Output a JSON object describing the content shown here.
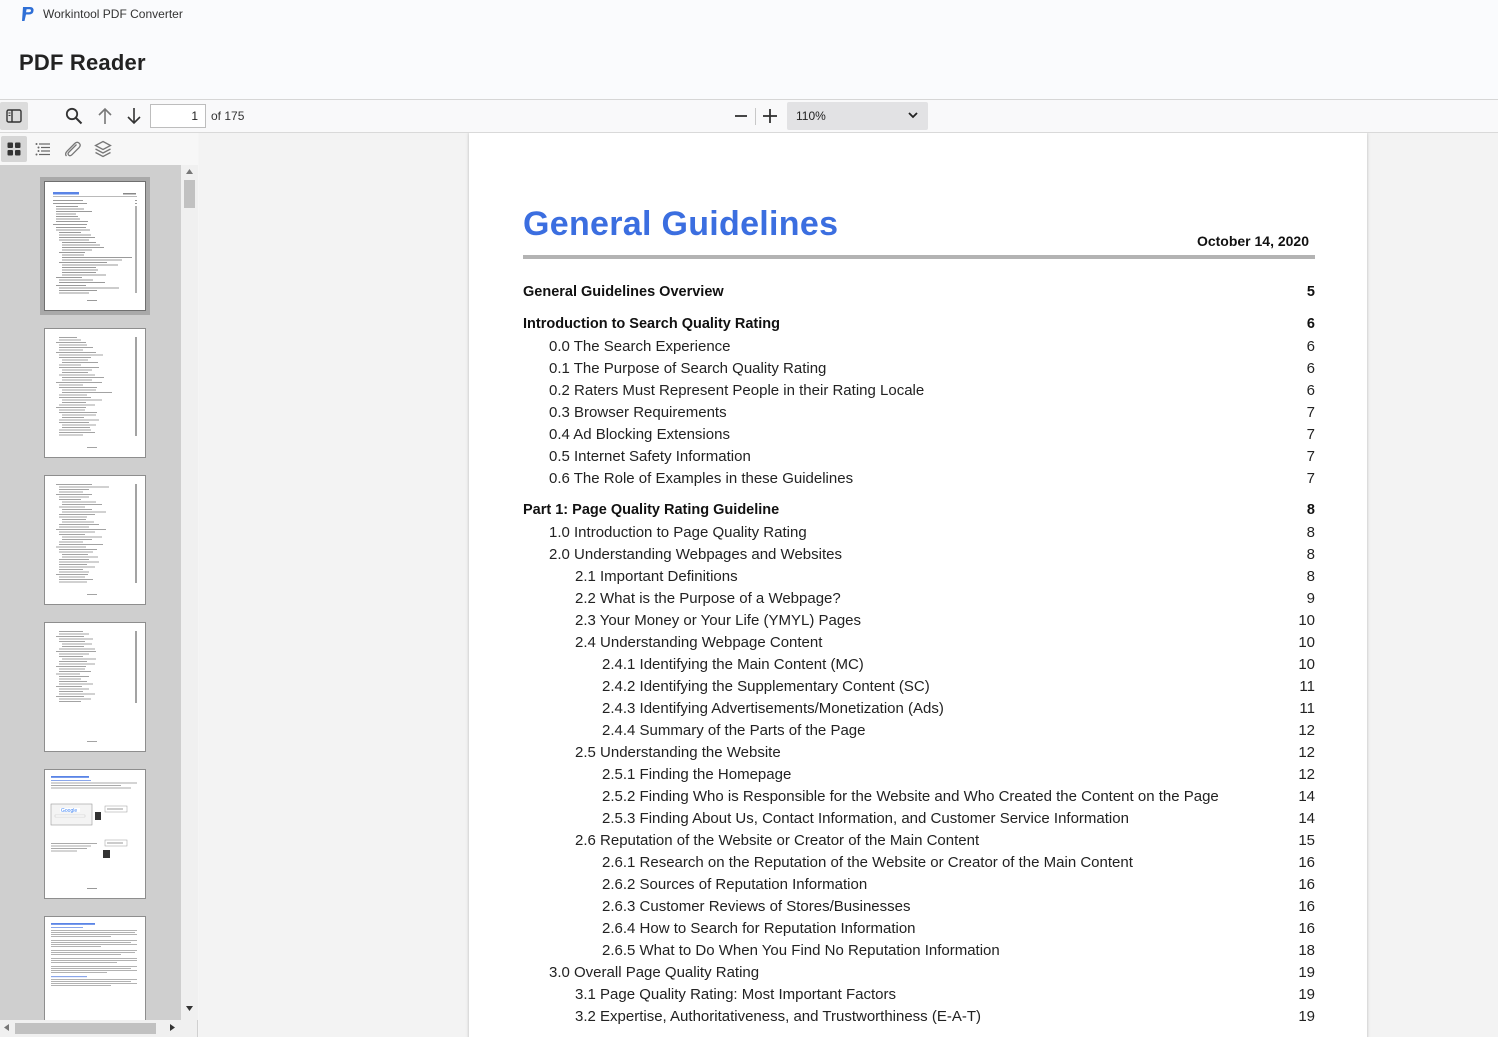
{
  "app": {
    "window_title": "Workintool PDF Converter",
    "heading": "PDF Reader"
  },
  "toolbar": {
    "page_input_value": "1",
    "page_count": "of 175",
    "zoom_value": "110%"
  },
  "icons": {
    "sidebar_toggle": "sidebar-toggle-icon",
    "search": "search-icon",
    "prev": "arrow-up-icon",
    "next": "arrow-down-icon",
    "zoom_out": "minus-icon",
    "zoom_in": "plus-icon",
    "thumbnails": "grid-icon",
    "outline": "list-icon",
    "attachments": "paperclip-icon",
    "layers": "layers-icon"
  },
  "colors": {
    "title_blue": "#3b6ee0",
    "logo_blue": "#2f6fd6"
  },
  "document": {
    "title": "General Guidelines",
    "date": "October 14, 2020",
    "toc": [
      {
        "label": "General Guidelines Overview",
        "page": "5",
        "level": 0
      },
      {
        "label": "Introduction to Search Quality Rating",
        "page": "6",
        "level": 0
      },
      {
        "label": "0.0 The Search Experience",
        "page": "6",
        "level": 1
      },
      {
        "label": "0.1 The Purpose of Search Quality Rating",
        "page": "6",
        "level": 1
      },
      {
        "label": "0.2 Raters Must Represent People in their Rating Locale",
        "page": "6",
        "level": 1
      },
      {
        "label": "0.3 Browser Requirements",
        "page": "7",
        "level": 1
      },
      {
        "label": "0.4 Ad Blocking Extensions",
        "page": "7",
        "level": 1
      },
      {
        "label": "0.5 Internet Safety Information",
        "page": "7",
        "level": 1
      },
      {
        "label": "0.6 The Role of Examples in these Guidelines",
        "page": "7",
        "level": 1
      },
      {
        "label": "Part 1: Page Quality Rating Guideline",
        "page": "8",
        "level": 0
      },
      {
        "label": "1.0 Introduction to Page Quality Rating",
        "page": "8",
        "level": 1
      },
      {
        "label": "2.0 Understanding Webpages and Websites",
        "page": "8",
        "level": 1
      },
      {
        "label": "2.1 Important Definitions",
        "page": "8",
        "level": 2
      },
      {
        "label": "2.2 What is the Purpose of a Webpage?",
        "page": "9",
        "level": 2
      },
      {
        "label": "2.3 Your Money or Your Life (YMYL) Pages",
        "page": "10",
        "level": 2
      },
      {
        "label": "2.4 Understanding Webpage Content",
        "page": "10",
        "level": 2
      },
      {
        "label": "2.4.1 Identifying the Main Content (MC)",
        "page": "10",
        "level": 3
      },
      {
        "label": "2.4.2 Identifying the Supplementary Content (SC)",
        "page": "11",
        "level": 3
      },
      {
        "label": "2.4.3 Identifying Advertisements/Monetization (Ads)",
        "page": "11",
        "level": 3
      },
      {
        "label": "2.4.4 Summary of the Parts of the Page",
        "page": "12",
        "level": 3
      },
      {
        "label": "2.5 Understanding the Website",
        "page": "12",
        "level": 2
      },
      {
        "label": "2.5.1 Finding the Homepage",
        "page": "12",
        "level": 3
      },
      {
        "label": "2.5.2 Finding Who is Responsible for the Website and Who Created the Content on the Page",
        "page": "14",
        "level": 3
      },
      {
        "label": "2.5.3 Finding About Us, Contact Information, and Customer Service Information",
        "page": "14",
        "level": 3
      },
      {
        "label": "2.6 Reputation of the Website or Creator of the Main Content",
        "page": "15",
        "level": 2
      },
      {
        "label": "2.6.1 Research on the Reputation of the Website or Creator of the Main Content",
        "page": "16",
        "level": 3
      },
      {
        "label": "2.6.2 Sources of Reputation Information",
        "page": "16",
        "level": 3
      },
      {
        "label": "2.6.3 Customer Reviews of Stores/Businesses",
        "page": "16",
        "level": 3
      },
      {
        "label": "2.6.4 How to Search for Reputation Information",
        "page": "16",
        "level": 3
      },
      {
        "label": "2.6.5 What to Do When You Find No Reputation Information",
        "page": "18",
        "level": 3
      },
      {
        "label": "3.0 Overall Page Quality Rating",
        "page": "19",
        "level": 1
      },
      {
        "label": "3.1 Page Quality Rating: Most Important Factors",
        "page": "19",
        "level": 2
      },
      {
        "label": "3.2 Expertise, Authoritativeness, and Trustworthiness (E-A-T)",
        "page": "19",
        "level": 2
      }
    ]
  },
  "thumbnails": {
    "selected_page": 1
  }
}
